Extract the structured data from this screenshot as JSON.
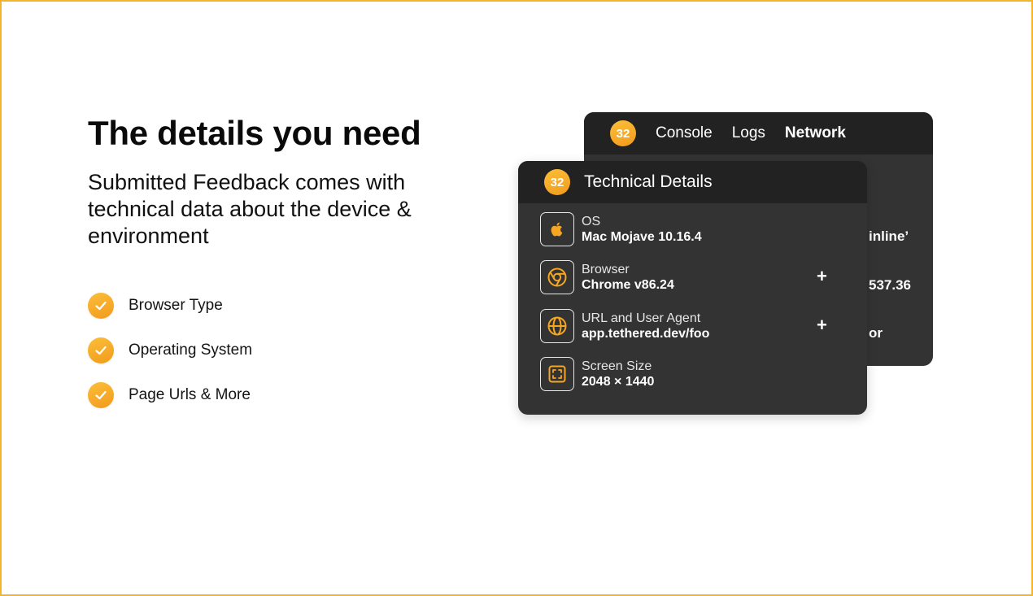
{
  "headline": "The details you need",
  "subtitle": "Submitted Feedback comes with technical data about the device & environment",
  "features": [
    {
      "label": "Browser Type",
      "icon": "check-icon"
    },
    {
      "label": "Operating System",
      "icon": "check-icon"
    },
    {
      "label": "Page Urls & More",
      "icon": "check-icon"
    }
  ],
  "back_panel": {
    "badge": "32",
    "tabs": [
      {
        "label": "Console",
        "active": false
      },
      {
        "label": "Logs",
        "active": false
      },
      {
        "label": "Network",
        "active": true
      }
    ],
    "fragments": [
      "inline’",
      "537.36",
      "or"
    ]
  },
  "front_panel": {
    "badge": "32",
    "title": "Technical Details",
    "rows": [
      {
        "label": "OS",
        "value": "Mac Mojave 10.16.4",
        "icon": "apple-icon",
        "expand": ""
      },
      {
        "label": "Browser",
        "value": "Chrome v86.24",
        "icon": "chrome-icon",
        "expand": "+"
      },
      {
        "label": "URL and User Agent",
        "value": "app.tethered.dev/foo",
        "icon": "globe-icon",
        "expand": "+"
      },
      {
        "label": "Screen Size",
        "value": "2048 × 1440",
        "icon": "screen-size-icon",
        "expand": ""
      }
    ]
  },
  "colors": {
    "accent": "#f5a623",
    "panel": "#333333",
    "panel_header": "#222222",
    "border": "#f5b52a"
  }
}
